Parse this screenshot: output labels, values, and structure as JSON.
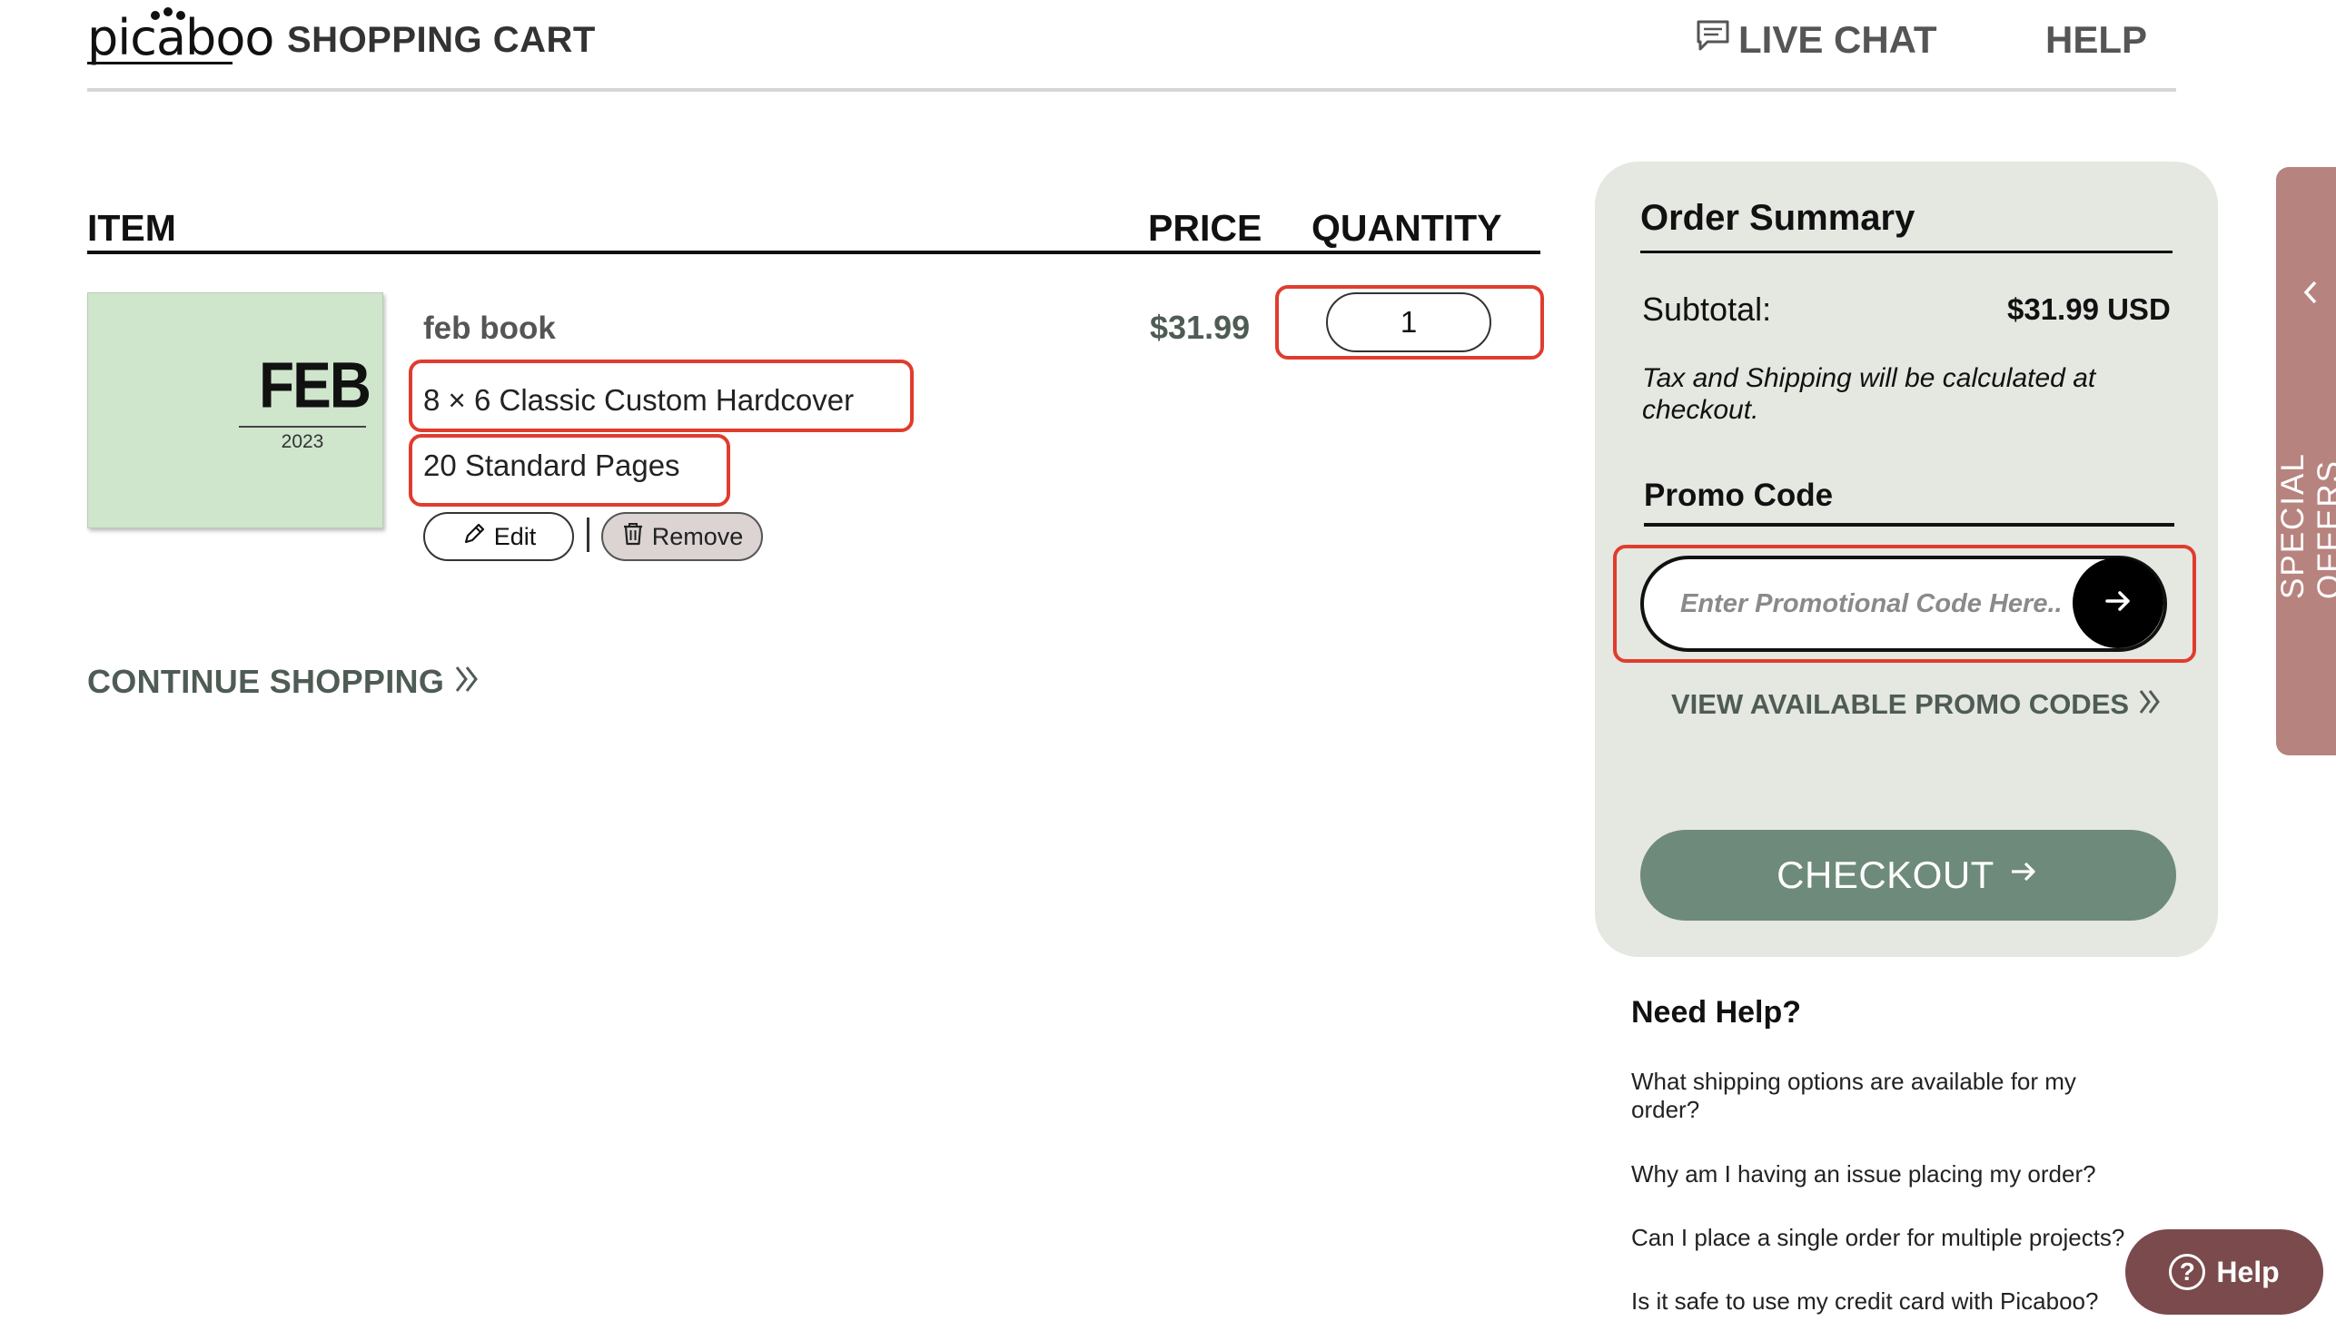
{
  "header": {
    "logo": "picaboo",
    "title": "SHOPPING CART",
    "live_chat": "LIVE CHAT",
    "help": "HELP"
  },
  "cart": {
    "columns": {
      "item": "ITEM",
      "price": "PRICE",
      "quantity": "QUANTITY"
    },
    "items": [
      {
        "thumbnail_title": "FEB",
        "thumbnail_year": "2023",
        "name": "feb book",
        "option_size": "8 × 6 Classic Custom Hardcover",
        "option_pages": "20 Standard Pages",
        "price": "$31.99",
        "quantity": "1",
        "edit_label": "Edit",
        "remove_label": "Remove"
      }
    ],
    "continue_shopping": "CONTINUE SHOPPING"
  },
  "summary": {
    "title": "Order Summary",
    "subtotal_label": "Subtotal:",
    "subtotal_value": "$31.99 USD",
    "tax_note": "Tax and Shipping will be calculated at checkout.",
    "promo_title": "Promo Code",
    "promo_placeholder": "Enter Promotional Code Here..",
    "view_promo": "VIEW AVAILABLE PROMO CODES",
    "checkout": "CHECKOUT"
  },
  "need_help": {
    "title": "Need Help?",
    "questions": [
      "What shipping options are available for my order?",
      "Why am I having an issue placing my order?",
      "Can I place a single order for multiple projects?",
      "Is it safe to use my credit card with Picaboo?"
    ]
  },
  "special_offers": "SPECIAL OFFERS",
  "help_bubble": "Help",
  "colors": {
    "accent_green": "#6e8a7a",
    "summary_bg": "#e5e7e1",
    "thumb_bg": "#cfe6cd",
    "offers_tab": "#b7837f",
    "help_bubble": "#7a4a4c",
    "highlight_red": "#e03c2e"
  }
}
